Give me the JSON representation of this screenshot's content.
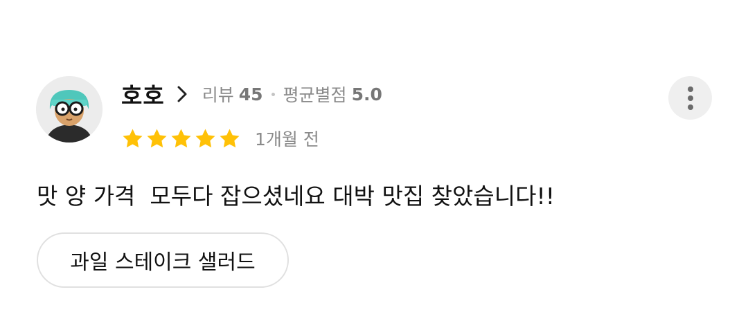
{
  "review": {
    "author": "호호",
    "review_count_label": "리뷰",
    "review_count": "45",
    "avg_rating_label": "평균별점",
    "avg_rating": "5.0",
    "star_count": 5,
    "time_ago": "1개월 전",
    "text": "맛 양 가격  모두다 잡으셨네요 대박 맛집 찾았습니다!!",
    "menu_tag": "과일 스테이크 샐러드"
  },
  "icons": {
    "avatar": "avatar-illustration",
    "chevron": "chevron-right-icon",
    "star": "star-icon",
    "more": "more-vertical-icon"
  },
  "colors": {
    "star": "#FFC107",
    "text_primary": "#111111",
    "text_secondary": "#8A8A8A"
  }
}
